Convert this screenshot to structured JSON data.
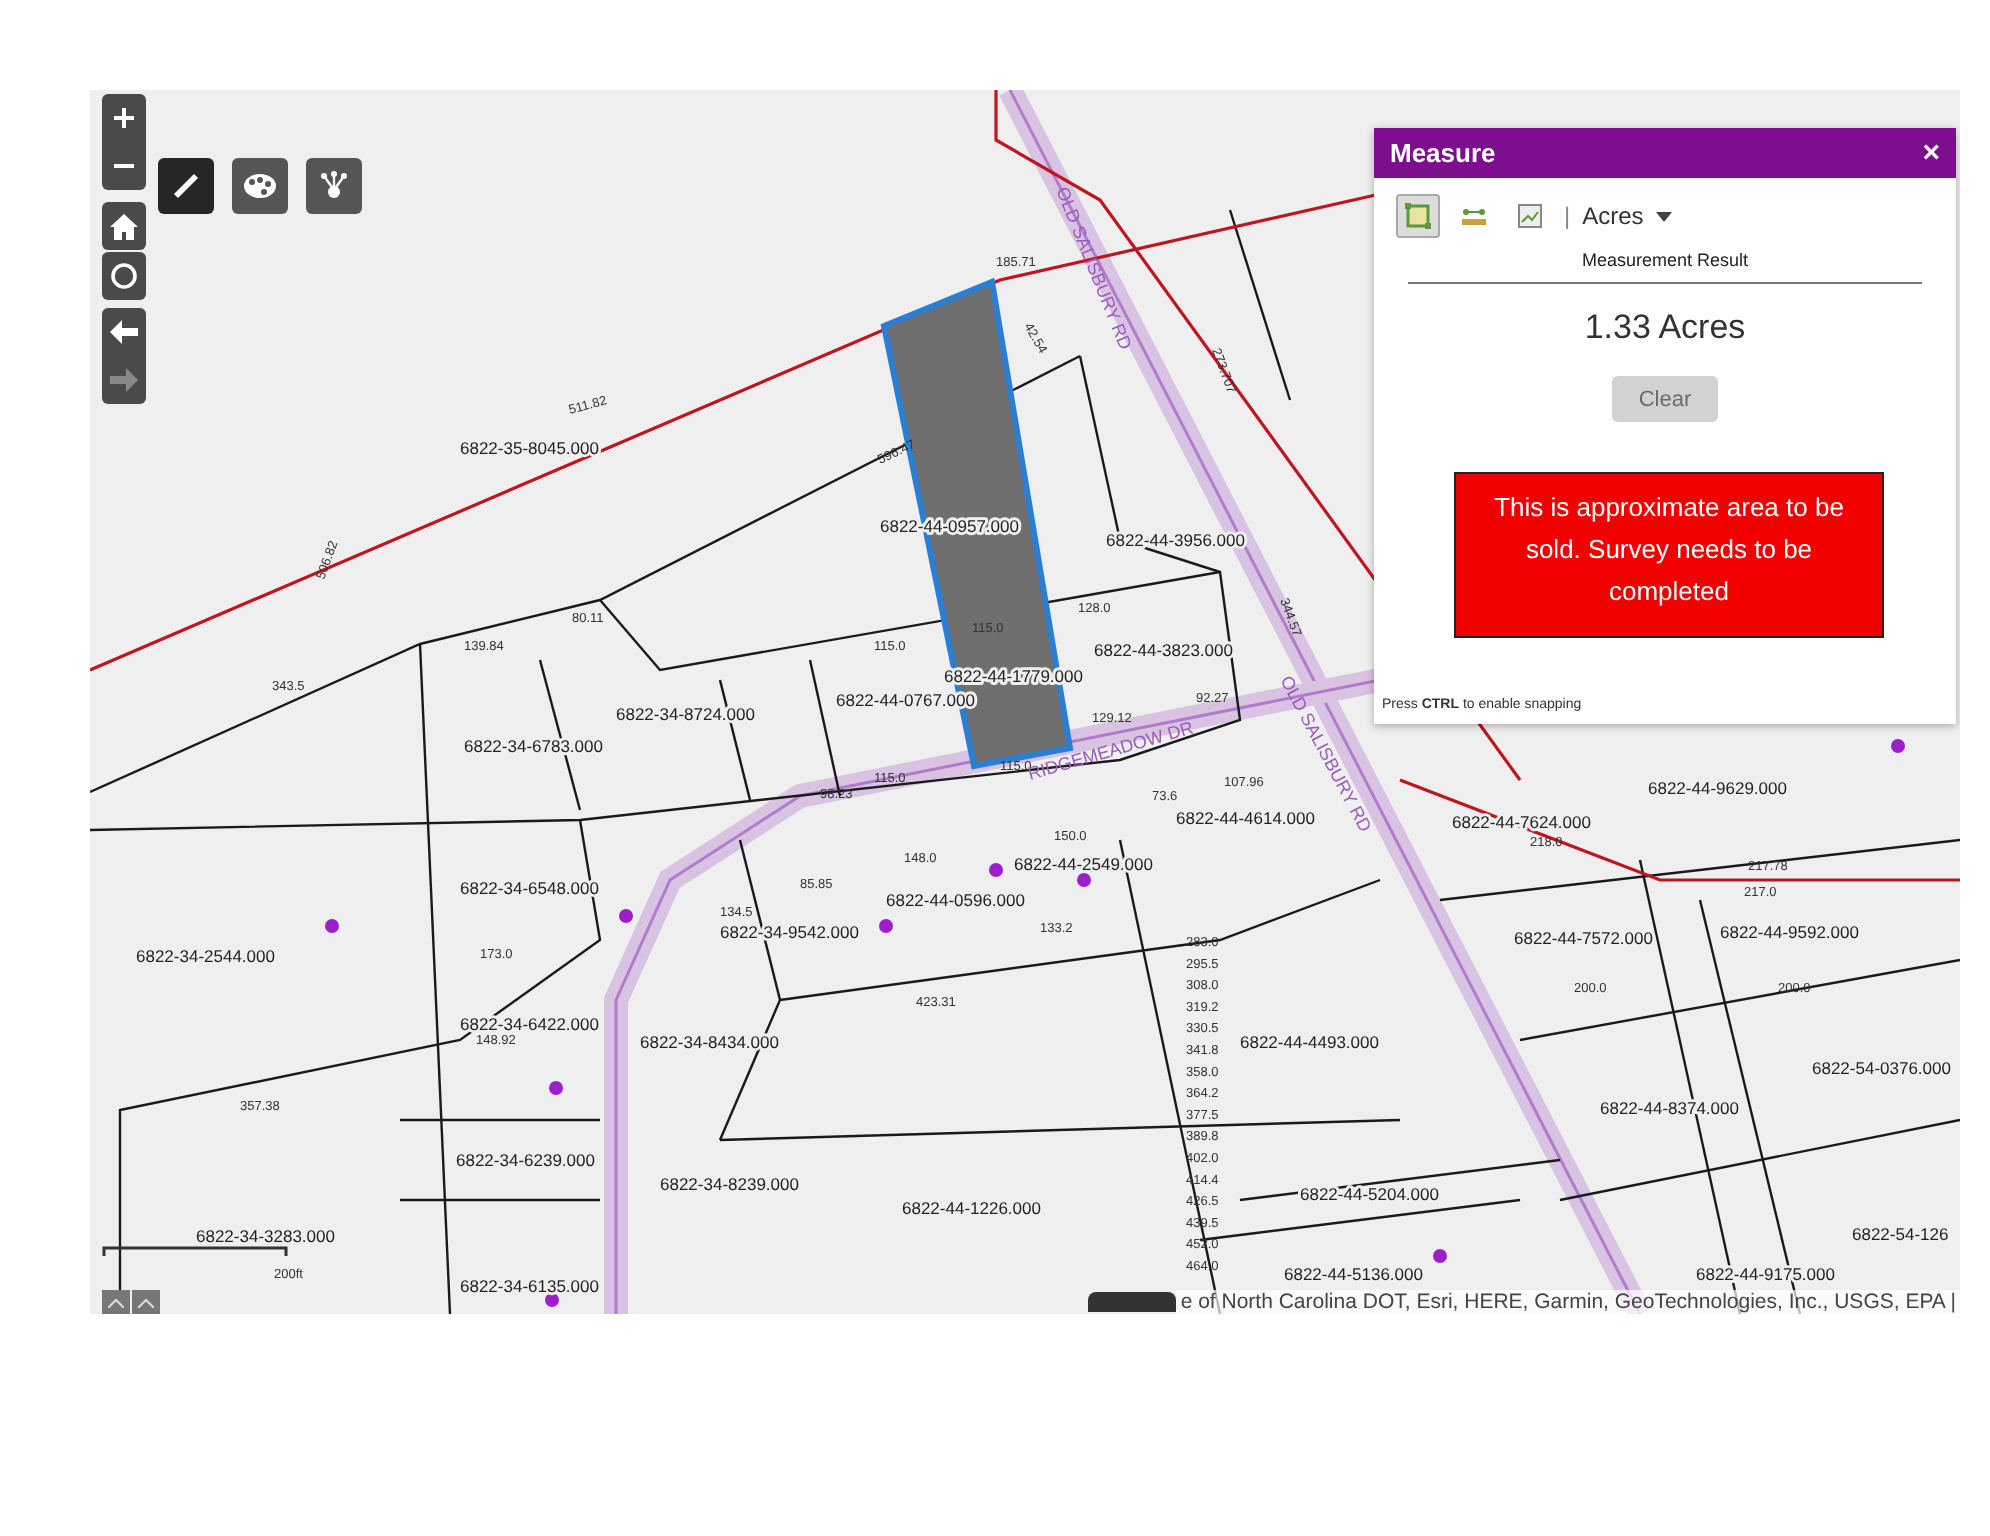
{
  "map": {
    "parcel_labels": [
      "6822-35-8045.000",
      "6822-44-0957.000",
      "6822-44-3956.000",
      "6822-44-3823.000",
      "6822-44-1779.000",
      "6822-44-0767.000",
      "6822-34-8724.000",
      "6822-34-6783.000",
      "6822-44-4614.000",
      "6822-44-7624.000",
      "6822-44-9629.000",
      "6822-34-6548.000",
      "6822-44-0596.000",
      "6822-44-2549.000",
      "6822-34-9542.000",
      "6822-44-7572.000",
      "6822-44-9592.000",
      "6822-34-2544.000",
      "6822-34-6422.000",
      "6822-34-8434.000",
      "6822-44-4493.000",
      "6822-54-0376.000",
      "6822-44-8374.000",
      "6822-34-6239.000",
      "6822-34-8239.000",
      "6822-34-3283.000",
      "6822-44-1226.000",
      "6822-44-5204.000",
      "6822-54-126",
      "6822-34-6135.000",
      "6822-44-5136.000",
      "6822-44-9175.000"
    ],
    "road_labels": [
      "OLD SALISBURY RD",
      "OLD SALISBURY RD",
      "RIDGEMEADOW DR"
    ],
    "dimension_labels": [
      "511.82",
      "506.82",
      "343.5",
      "139.84",
      "80.11",
      "115.0",
      "115.0",
      "128.0",
      "129.12",
      "92.27",
      "115.0",
      "115.0",
      "98.23",
      "173.0",
      "357.38",
      "148.92",
      "423.31",
      "150.0",
      "148.0",
      "133.2",
      "85.85",
      "134.5",
      "218.0",
      "217.0",
      "217.78",
      "107.96",
      "73.6",
      "344.57",
      "273.707",
      "185.71",
      "42.54",
      "596.47",
      "200.0",
      "200.0"
    ],
    "stacked_dimensions": [
      "283.0",
      "295.5",
      "308.0",
      "319.2",
      "330.5",
      "341.8",
      "358.0",
      "364.2",
      "377.5",
      "389.8",
      "402.0",
      "414.4",
      "426.5",
      "439.5",
      "452.0",
      "464.0"
    ],
    "scale_bar": {
      "label": "200ft"
    },
    "attribution": "e of North Carolina DOT, Esri, HERE, Garmin, GeoTechnologies, Inc., USGS, EPA |",
    "tools": [
      {
        "kind": "draw",
        "selected": true
      },
      {
        "kind": "style",
        "selected": false
      },
      {
        "kind": "network",
        "selected": false
      }
    ],
    "nav": [
      {
        "kind": "back",
        "disabled": false
      },
      {
        "kind": "forward",
        "disabled": true
      }
    ]
  },
  "measure_panel": {
    "title": "Measure",
    "close": "×",
    "tools": [
      {
        "kind": "area",
        "selected": true
      },
      {
        "kind": "distance",
        "selected": false
      },
      {
        "kind": "location",
        "selected": false
      }
    ],
    "separator": "|",
    "unit": "Acres",
    "result_label": "Measurement Result",
    "result": "1.33 Acres",
    "clear_button": {
      "label": "Clear",
      "disabled": true
    },
    "note": "This is approximate area to be sold.  Survey needs to be completed",
    "hint": "Press **CTRL** to enable snapping"
  }
}
